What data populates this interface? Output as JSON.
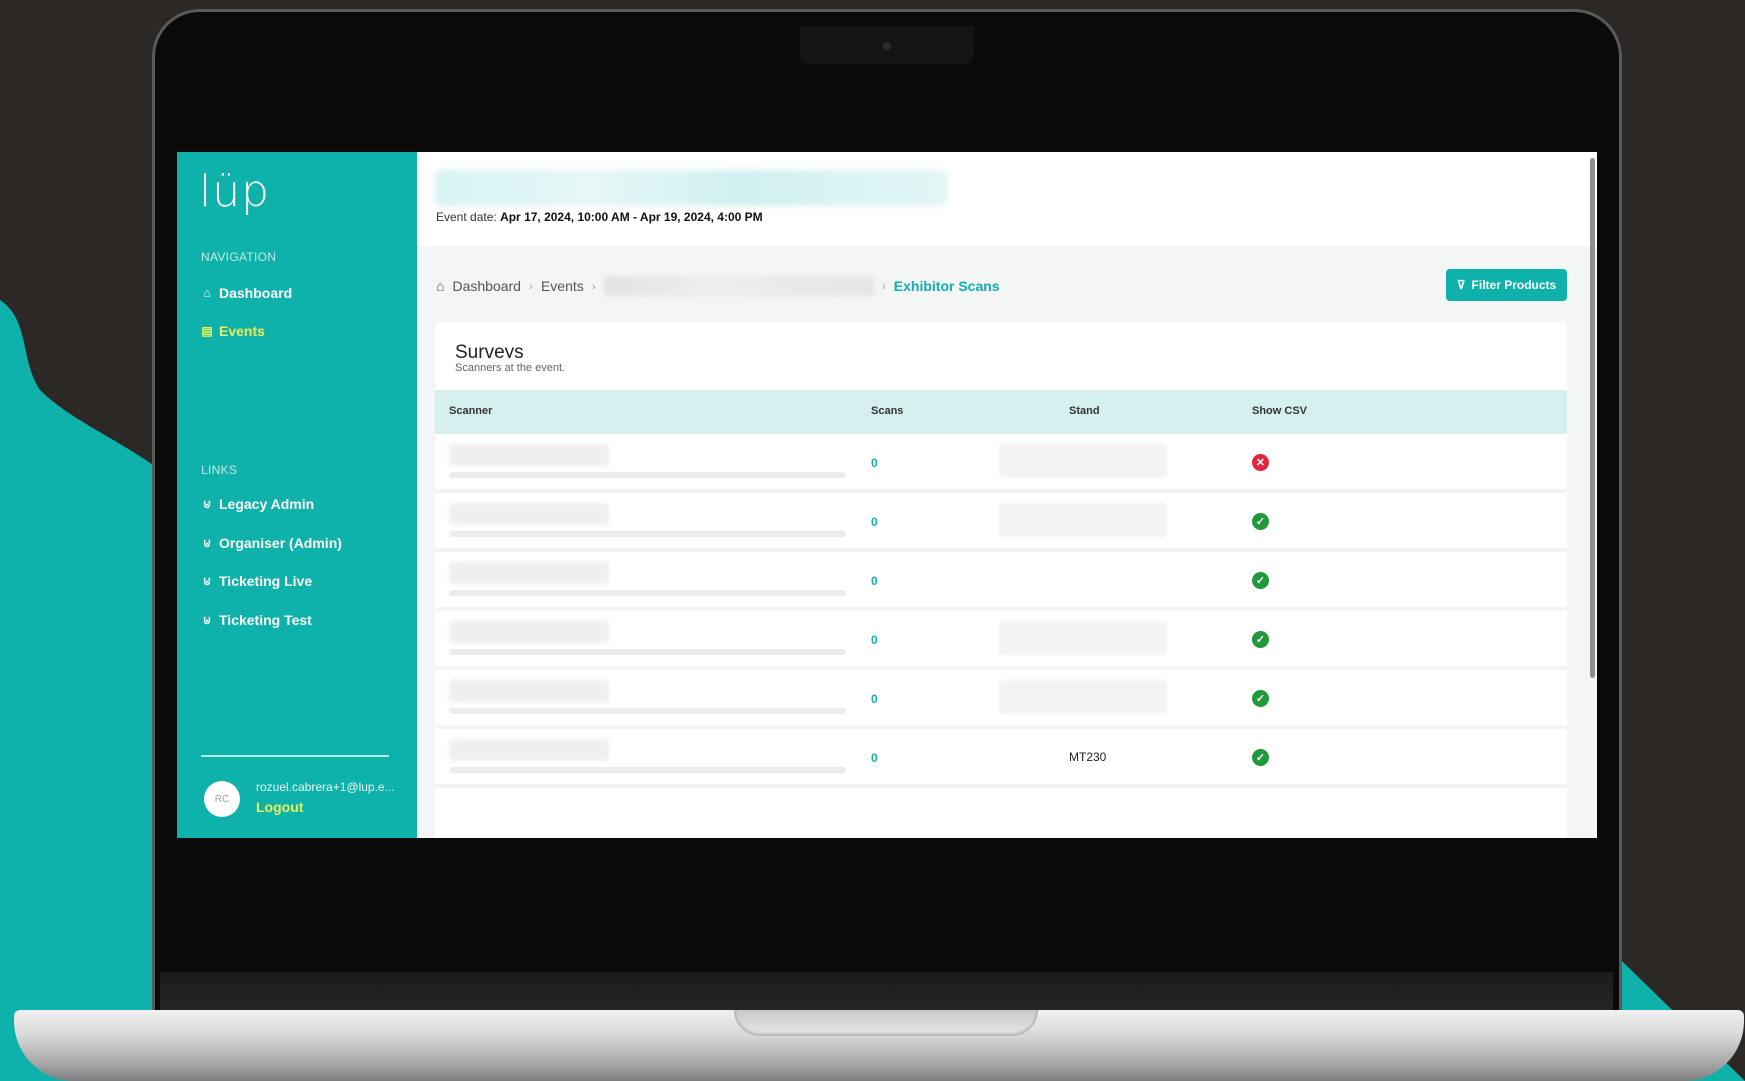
{
  "colors": {
    "accent": "#0fb1ab",
    "active_nav": "#e8f05a",
    "ok": "#1f9a3a",
    "error": "#e3243b",
    "table_header_bg": "#d6efef"
  },
  "sidebar": {
    "logo": "lüp",
    "navigation_heading": "NAVIGATION",
    "nav_items": [
      {
        "label": "Dashboard",
        "icon": "home-icon"
      },
      {
        "label": "Events",
        "icon": "calendar-icon"
      }
    ],
    "links_heading": "LINKS",
    "link_items": [
      {
        "label": "Legacy Admin",
        "icon": "link-icon"
      },
      {
        "label": "Organiser (Admin)",
        "icon": "link-icon"
      },
      {
        "label": "Ticketing Live",
        "icon": "link-icon"
      },
      {
        "label": "Ticketing Test",
        "icon": "link-icon"
      }
    ],
    "user": {
      "initials": "RC",
      "email": "rozuel.cabrera+1@lup.e...",
      "logout_label": "Logout"
    }
  },
  "header": {
    "event_date_label": "Event date:",
    "event_date_value": "Apr 17, 2024, 10:00 AM - Apr 19, 2024, 4:00 PM"
  },
  "breadcrumb": {
    "dashboard": "Dashboard",
    "events": "Events",
    "current": "Exhibitor Scans"
  },
  "filter_button": {
    "label": "Filter Products",
    "icon": "filter-icon"
  },
  "card": {
    "title": "Surveys",
    "subtitle": "Scanners at the event."
  },
  "table": {
    "columns": [
      "Scanner",
      "Scans",
      "Stand",
      "Show CSV"
    ],
    "rows": [
      {
        "scans": "0",
        "stand": "",
        "stand_blurred": true,
        "csv": "error"
      },
      {
        "scans": "0",
        "stand": "",
        "stand_blurred": true,
        "csv": "ok"
      },
      {
        "scans": "0",
        "stand": "",
        "stand_blurred": false,
        "csv": "ok"
      },
      {
        "scans": "0",
        "stand": "",
        "stand_blurred": true,
        "csv": "ok"
      },
      {
        "scans": "0",
        "stand": "",
        "stand_blurred": true,
        "csv": "ok"
      },
      {
        "scans": "0",
        "stand": "MT230",
        "stand_blurred": false,
        "csv": "ok"
      }
    ]
  }
}
